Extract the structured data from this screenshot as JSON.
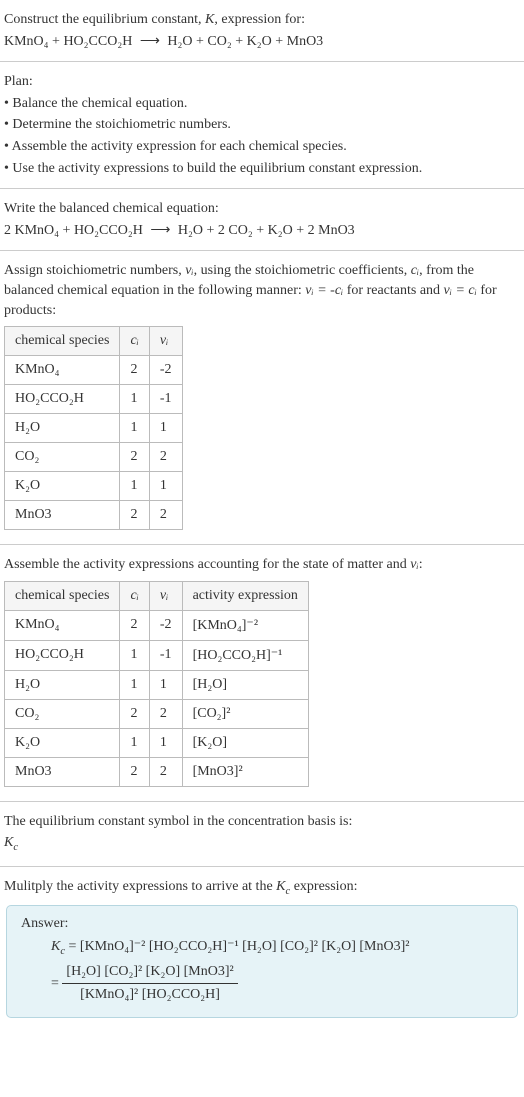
{
  "header": {
    "line1": "Construct the equilibrium constant, ",
    "kvar": "K",
    "line1b": ", expression for:",
    "eq_lhs": "KMnO₄ + HO₂CCO₂H",
    "eq_arrow": "⟶",
    "eq_rhs": "H₂O + CO₂ + K₂O + MnO3"
  },
  "plan": {
    "title": "Plan:",
    "b1": "• Balance the chemical equation.",
    "b2": "• Determine the stoichiometric numbers.",
    "b3": "• Assemble the activity expression for each chemical species.",
    "b4": "• Use the activity expressions to build the equilibrium constant expression."
  },
  "balanced": {
    "title": "Write the balanced chemical equation:",
    "lhs": "2 KMnO₄ + HO₂CCO₂H",
    "arrow": "⟶",
    "rhs": "H₂O + 2 CO₂ + K₂O + 2 MnO3"
  },
  "stoich": {
    "intro1": "Assign stoichiometric numbers, ",
    "nu": "νᵢ",
    "intro2": ", using the stoichiometric coefficients, ",
    "ci": "cᵢ",
    "intro3": ", from the balanced chemical equation in the following manner: ",
    "rel1": "νᵢ = -cᵢ",
    "intro4": " for reactants and ",
    "rel2": "νᵢ = cᵢ",
    "intro5": " for products:",
    "h1": "chemical species",
    "h2": "cᵢ",
    "h3": "νᵢ",
    "rows": [
      {
        "s": "KMnO₄",
        "c": "2",
        "n": "-2"
      },
      {
        "s": "HO₂CCO₂H",
        "c": "1",
        "n": "-1"
      },
      {
        "s": "H₂O",
        "c": "1",
        "n": "1"
      },
      {
        "s": "CO₂",
        "c": "2",
        "n": "2"
      },
      {
        "s": "K₂O",
        "c": "1",
        "n": "1"
      },
      {
        "s": "MnO3",
        "c": "2",
        "n": "2"
      }
    ]
  },
  "activity": {
    "intro": "Assemble the activity expressions accounting for the state of matter and ",
    "nu": "νᵢ",
    "colon": ":",
    "h1": "chemical species",
    "h2": "cᵢ",
    "h3": "νᵢ",
    "h4": "activity expression",
    "rows": [
      {
        "s": "KMnO₄",
        "c": "2",
        "n": "-2",
        "a": "[KMnO₄]⁻²"
      },
      {
        "s": "HO₂CCO₂H",
        "c": "1",
        "n": "-1",
        "a": "[HO₂CCO₂H]⁻¹"
      },
      {
        "s": "H₂O",
        "c": "1",
        "n": "1",
        "a": "[H₂O]"
      },
      {
        "s": "CO₂",
        "c": "2",
        "n": "2",
        "a": "[CO₂]²"
      },
      {
        "s": "K₂O",
        "c": "1",
        "n": "1",
        "a": "[K₂O]"
      },
      {
        "s": "MnO3",
        "c": "2",
        "n": "2",
        "a": "[MnO3]²"
      }
    ]
  },
  "ksym": {
    "line": "The equilibrium constant symbol in the concentration basis is:",
    "kc": "K_c"
  },
  "mult": {
    "line1": "Mulitply the activity expressions to arrive at the ",
    "kc": "K_c",
    "line2": " expression:"
  },
  "answer": {
    "label": "Answer:",
    "kc": "K_c",
    "eq1": " = [KMnO₄]⁻² [HO₂CCO₂H]⁻¹ [H₂O] [CO₂]² [K₂O] [MnO3]²",
    "eq2_eq": " = ",
    "num": "[H₂O] [CO₂]² [K₂O] [MnO3]²",
    "den": "[KMnO₄]² [HO₂CCO₂H]"
  }
}
